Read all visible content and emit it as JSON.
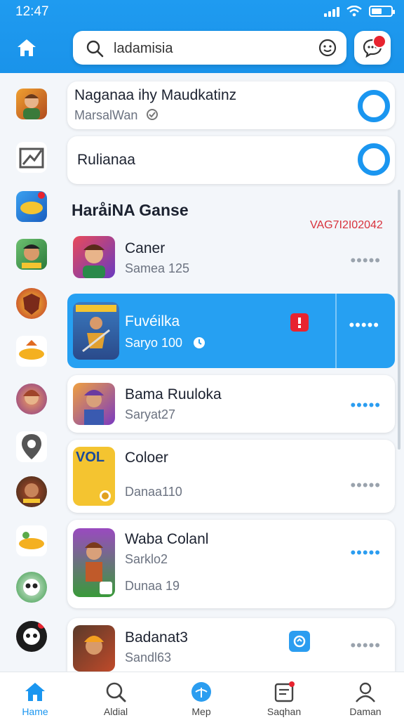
{
  "status": {
    "time": "12:47"
  },
  "search": {
    "value": "ladamisia"
  },
  "featured": [
    {
      "title": "Naganaa ihy Maudkatinz",
      "subtitle": "MarsalWan"
    },
    {
      "title": "Rulianaa"
    }
  ],
  "section": {
    "title": "HaråiNA Ganse",
    "date": "VAG7I2I02042"
  },
  "games": [
    {
      "name": "Caner",
      "sub": "Samea 125"
    },
    {
      "name": "Fuvéilka",
      "sub": "Saryo 100",
      "active": true
    },
    {
      "name": "Bama Ruuloka",
      "sub": "Saryat27"
    },
    {
      "name": "Coloer",
      "sub": "Danaa110",
      "thumb_text": "VOL"
    },
    {
      "name": "Waba Colanl",
      "sub": "Sarklo2",
      "sub2": "Dunaa 19"
    },
    {
      "name": "Badanat3",
      "sub": "Sandl63"
    }
  ],
  "more_label": "•••••",
  "nav": [
    {
      "label": "Hame",
      "icon": "home-icon"
    },
    {
      "label": "Aldial",
      "icon": "search-icon"
    },
    {
      "label": "Mep",
      "icon": "globe-icon"
    },
    {
      "label": "Saqhan",
      "icon": "notes-icon"
    },
    {
      "label": "Daman",
      "icon": "profile-icon"
    }
  ],
  "colors": {
    "primary": "#1a96f0",
    "active_row": "#26a0f2",
    "badge_red": "#e8232f"
  }
}
